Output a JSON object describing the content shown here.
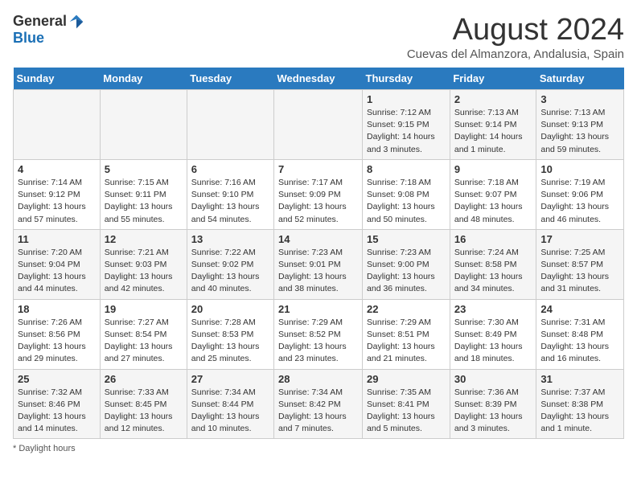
{
  "header": {
    "logo_general": "General",
    "logo_blue": "Blue",
    "month_title": "August 2024",
    "location": "Cuevas del Almanzora, Andalusia, Spain"
  },
  "calendar": {
    "days_of_week": [
      "Sunday",
      "Monday",
      "Tuesday",
      "Wednesday",
      "Thursday",
      "Friday",
      "Saturday"
    ],
    "weeks": [
      [
        {
          "day": "",
          "info": ""
        },
        {
          "day": "",
          "info": ""
        },
        {
          "day": "",
          "info": ""
        },
        {
          "day": "",
          "info": ""
        },
        {
          "day": "1",
          "info": "Sunrise: 7:12 AM\nSunset: 9:15 PM\nDaylight: 14 hours and 3 minutes."
        },
        {
          "day": "2",
          "info": "Sunrise: 7:13 AM\nSunset: 9:14 PM\nDaylight: 14 hours and 1 minute."
        },
        {
          "day": "3",
          "info": "Sunrise: 7:13 AM\nSunset: 9:13 PM\nDaylight: 13 hours and 59 minutes."
        }
      ],
      [
        {
          "day": "4",
          "info": "Sunrise: 7:14 AM\nSunset: 9:12 PM\nDaylight: 13 hours and 57 minutes."
        },
        {
          "day": "5",
          "info": "Sunrise: 7:15 AM\nSunset: 9:11 PM\nDaylight: 13 hours and 55 minutes."
        },
        {
          "day": "6",
          "info": "Sunrise: 7:16 AM\nSunset: 9:10 PM\nDaylight: 13 hours and 54 minutes."
        },
        {
          "day": "7",
          "info": "Sunrise: 7:17 AM\nSunset: 9:09 PM\nDaylight: 13 hours and 52 minutes."
        },
        {
          "day": "8",
          "info": "Sunrise: 7:18 AM\nSunset: 9:08 PM\nDaylight: 13 hours and 50 minutes."
        },
        {
          "day": "9",
          "info": "Sunrise: 7:18 AM\nSunset: 9:07 PM\nDaylight: 13 hours and 48 minutes."
        },
        {
          "day": "10",
          "info": "Sunrise: 7:19 AM\nSunset: 9:06 PM\nDaylight: 13 hours and 46 minutes."
        }
      ],
      [
        {
          "day": "11",
          "info": "Sunrise: 7:20 AM\nSunset: 9:04 PM\nDaylight: 13 hours and 44 minutes."
        },
        {
          "day": "12",
          "info": "Sunrise: 7:21 AM\nSunset: 9:03 PM\nDaylight: 13 hours and 42 minutes."
        },
        {
          "day": "13",
          "info": "Sunrise: 7:22 AM\nSunset: 9:02 PM\nDaylight: 13 hours and 40 minutes."
        },
        {
          "day": "14",
          "info": "Sunrise: 7:23 AM\nSunset: 9:01 PM\nDaylight: 13 hours and 38 minutes."
        },
        {
          "day": "15",
          "info": "Sunrise: 7:23 AM\nSunset: 9:00 PM\nDaylight: 13 hours and 36 minutes."
        },
        {
          "day": "16",
          "info": "Sunrise: 7:24 AM\nSunset: 8:58 PM\nDaylight: 13 hours and 34 minutes."
        },
        {
          "day": "17",
          "info": "Sunrise: 7:25 AM\nSunset: 8:57 PM\nDaylight: 13 hours and 31 minutes."
        }
      ],
      [
        {
          "day": "18",
          "info": "Sunrise: 7:26 AM\nSunset: 8:56 PM\nDaylight: 13 hours and 29 minutes."
        },
        {
          "day": "19",
          "info": "Sunrise: 7:27 AM\nSunset: 8:54 PM\nDaylight: 13 hours and 27 minutes."
        },
        {
          "day": "20",
          "info": "Sunrise: 7:28 AM\nSunset: 8:53 PM\nDaylight: 13 hours and 25 minutes."
        },
        {
          "day": "21",
          "info": "Sunrise: 7:29 AM\nSunset: 8:52 PM\nDaylight: 13 hours and 23 minutes."
        },
        {
          "day": "22",
          "info": "Sunrise: 7:29 AM\nSunset: 8:51 PM\nDaylight: 13 hours and 21 minutes."
        },
        {
          "day": "23",
          "info": "Sunrise: 7:30 AM\nSunset: 8:49 PM\nDaylight: 13 hours and 18 minutes."
        },
        {
          "day": "24",
          "info": "Sunrise: 7:31 AM\nSunset: 8:48 PM\nDaylight: 13 hours and 16 minutes."
        }
      ],
      [
        {
          "day": "25",
          "info": "Sunrise: 7:32 AM\nSunset: 8:46 PM\nDaylight: 13 hours and 14 minutes."
        },
        {
          "day": "26",
          "info": "Sunrise: 7:33 AM\nSunset: 8:45 PM\nDaylight: 13 hours and 12 minutes."
        },
        {
          "day": "27",
          "info": "Sunrise: 7:34 AM\nSunset: 8:44 PM\nDaylight: 13 hours and 10 minutes."
        },
        {
          "day": "28",
          "info": "Sunrise: 7:34 AM\nSunset: 8:42 PM\nDaylight: 13 hours and 7 minutes."
        },
        {
          "day": "29",
          "info": "Sunrise: 7:35 AM\nSunset: 8:41 PM\nDaylight: 13 hours and 5 minutes."
        },
        {
          "day": "30",
          "info": "Sunrise: 7:36 AM\nSunset: 8:39 PM\nDaylight: 13 hours and 3 minutes."
        },
        {
          "day": "31",
          "info": "Sunrise: 7:37 AM\nSunset: 8:38 PM\nDaylight: 13 hours and 1 minute."
        }
      ]
    ]
  },
  "footer": {
    "note": "Daylight hours"
  }
}
